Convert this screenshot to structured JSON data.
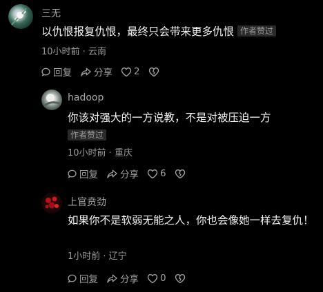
{
  "comments": [
    {
      "user": "三无",
      "text": "以仇恨报复仇恨，最终只会带来更多仇恨",
      "badge": "作者赞过",
      "meta": "10小时前 · 云南",
      "reply": "回复",
      "share": "分享",
      "likes": "2"
    },
    {
      "user": "hadoop",
      "text": "你该对强大的一方说教，不是对被压迫一方",
      "badge": "作者赞过",
      "meta": "10小时前 · 重庆",
      "reply": "回复",
      "share": "分享",
      "likes": "6"
    },
    {
      "user": "上官贲劲",
      "text": "如果你不是软弱无能之人，你也会像她一样去复仇！",
      "meta": "1小时前 · 辽宁",
      "reply": "回复",
      "share": "分享",
      "likes": "0"
    }
  ]
}
